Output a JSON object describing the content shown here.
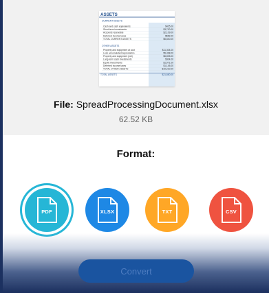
{
  "preview": {
    "sheet": {
      "title": "ASSETS",
      "current_header": "CURRENT ASSETS",
      "current_rows": [
        {
          "label": "Cash and cash equivalents",
          "value": "$425.00"
        },
        {
          "label": "Short-term investments",
          "value": "$3,700.00"
        },
        {
          "label": "Accounts receivable",
          "value": "$2,109.00"
        },
        {
          "label": "Deferred income taxes",
          "value": "$552.00"
        }
      ],
      "current_total": {
        "label": "TOTAL CURRENT ASSETS",
        "value": "$6,840.00"
      },
      "other_header": "OTHER ASSETS",
      "other_rows": [
        {
          "label": "Property and equipment at cost",
          "value": "$11,304.00"
        },
        {
          "label": "Less accumulated depreciation",
          "value": "$5,498.00"
        },
        {
          "label": "Property and equipment (net)",
          "value": "$6,805.00"
        },
        {
          "label": "Long-term cash investments",
          "value": "$304.00"
        },
        {
          "label": "Equity investments",
          "value": "$1,971.00"
        },
        {
          "label": "Deferred income taxes",
          "value": "$1,145.00"
        },
        {
          "label": "TOTAL OTHER ASSETS",
          "value": "$10,210.00"
        }
      ],
      "grand_total": {
        "label": "TOTAL ASSETS",
        "value": "$21,850.00"
      }
    }
  },
  "file": {
    "label": "File:",
    "name": "SpreadProcessingDocument.xlsx",
    "size": "62.52 KB"
  },
  "format": {
    "title": "Format:",
    "options": [
      {
        "ext": "PDF",
        "color": "#26b6d6",
        "selected": true
      },
      {
        "ext": "XLSX",
        "color": "#1e88e5",
        "selected": false
      },
      {
        "ext": "TXT",
        "color": "#ffa726",
        "selected": false
      },
      {
        "ext": "CSV",
        "color": "#ef5340",
        "selected": false
      }
    ]
  },
  "actions": {
    "convert_label": "Convert"
  }
}
